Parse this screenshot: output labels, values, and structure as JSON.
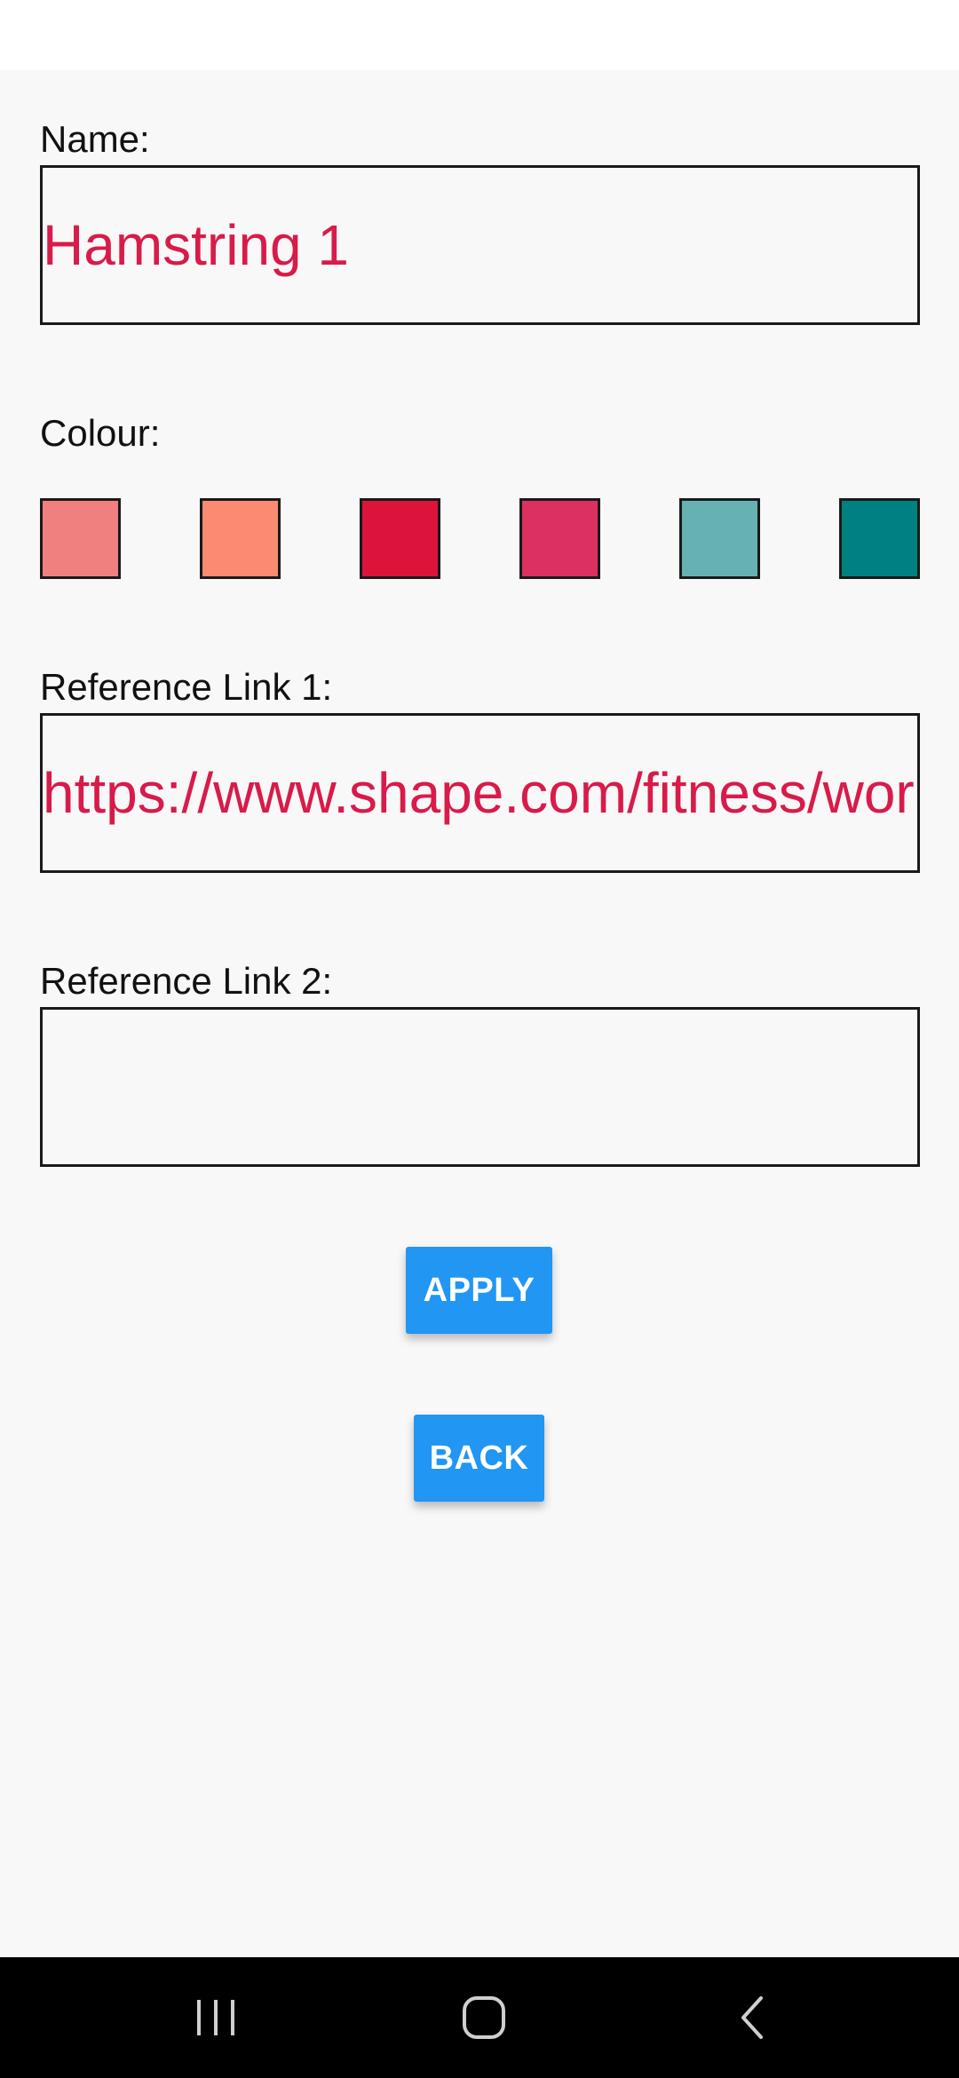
{
  "form": {
    "name_label": "Name:",
    "name_value": "Hamstring 1",
    "colour_label": "Colour:",
    "colours": [
      "#f08080",
      "#fa8a70",
      "#dc143c",
      "#dc3060",
      "#66b2b2",
      "#008080"
    ],
    "ref1_label": "Reference Link 1:",
    "ref1_value": "https://www.shape.com/fitness/workouts",
    "ref2_label": "Reference Link 2:",
    "ref2_value": ""
  },
  "buttons": {
    "apply_label": "APPLY",
    "back_label": "BACK"
  },
  "accent_colors": {
    "input_text": "#d81b4a",
    "button": "#2196f3"
  },
  "navbar": {
    "icons": [
      "recent-apps-icon",
      "home-icon",
      "back-arrow-icon"
    ]
  }
}
